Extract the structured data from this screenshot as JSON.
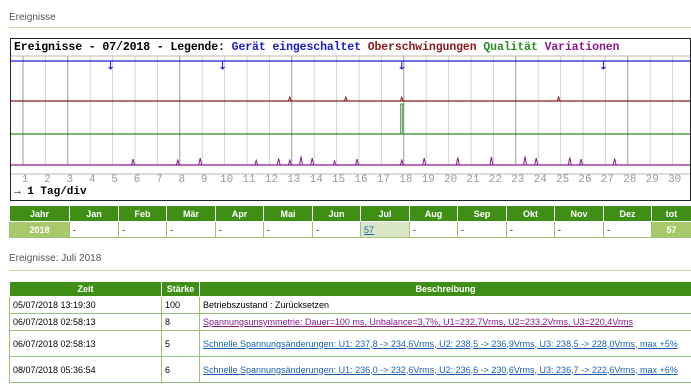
{
  "page": {
    "title": "Ereignisse",
    "subtitle": "Ereignisse: Juli 2018"
  },
  "chart": {
    "header_prefix": "Ereignisse - 07/2018 - Legende:",
    "legend": [
      {
        "label": "Gerät eingeschaltet",
        "color": "#1a1acc"
      },
      {
        "label": "Oberschwingungen",
        "color": "#8b1a1a"
      },
      {
        "label": "Qualität",
        "color": "#2a8a2a"
      },
      {
        "label": "Variationen",
        "color": "#8a1a8a"
      }
    ],
    "scale_label": "→ 1 Tag/div"
  },
  "chart_data": {
    "type": "line",
    "x_ticks": [
      "1",
      "2",
      "3",
      "4",
      "5",
      "6",
      "7",
      "8",
      "9",
      "10",
      "11",
      "12",
      "13",
      "14",
      "15",
      "16",
      "17",
      "18",
      "19",
      "20",
      "21",
      "22",
      "23",
      "24",
      "25",
      "26",
      "27",
      "28",
      "29",
      "30",
      "31"
    ],
    "series": [
      {
        "name": "Gerät eingeschaltet",
        "color": "#1a1acc",
        "events": [
          5,
          10,
          18,
          27
        ]
      },
      {
        "name": "Oberschwingungen",
        "color": "#8b1a1a",
        "events": [
          13,
          15.5,
          18,
          25
        ]
      },
      {
        "name": "Qualität",
        "color": "#2a8a2a",
        "events": [
          18
        ]
      },
      {
        "name": "Variationen",
        "color": "#8a1a8a",
        "events": [
          6,
          8,
          9,
          11.5,
          12.5,
          13,
          13.5,
          14,
          15,
          16,
          18,
          19,
          20.5,
          22,
          23.5,
          24,
          25.5,
          26,
          27.5
        ]
      }
    ]
  },
  "months_table": {
    "headers": [
      "Jahr",
      "Jan",
      "Feb",
      "Mär",
      "Apr",
      "Mai",
      "Jun",
      "Jul",
      "Aug",
      "Sep",
      "Okt",
      "Nov",
      "Dez",
      "tot"
    ],
    "row": [
      "2018",
      "-",
      "-",
      "-",
      "-",
      "-",
      "-",
      "57",
      "-",
      "-",
      "-",
      "-",
      "-",
      "57"
    ]
  },
  "events_table": {
    "headers": [
      "Zeit",
      "Stärke",
      "Beschreibung"
    ],
    "rows": [
      {
        "time": "05/07/2018 13:19:30",
        "strength": "100",
        "desc": "Betriebszustand : Zurücksetzen",
        "link": false
      },
      {
        "time": "06/07/2018 02:58:13",
        "strength": "8",
        "desc": "Spannungsunsymmetrie: Dauer=100 ms, Unbalance=3,7%, U1=232,7Vrms, U2=233,2Vrms, U3=220,4Vrms",
        "link": true,
        "color": "purple"
      },
      {
        "time": "06/07/2018 02:58:13",
        "strength": "5",
        "desc": "Schnelle Spannungsänderungen: U1: 237,8 -> 234,6Vrms, U2: 238,5 -> 236,9Vrms, U3: 238,5 -> 228,0Vrms, max +5%",
        "link": true,
        "color": "blue"
      },
      {
        "time": "08/07/2018 05:36:54",
        "strength": "6",
        "desc": "Schnelle Spannungsänderungen: U1: 236,0 -> 232,6Vrms, U2: 236,6 -> 230,6Vrms, U3: 236,7 -> 222,6Vrms, max +6%",
        "link": true,
        "color": "blue"
      }
    ]
  }
}
